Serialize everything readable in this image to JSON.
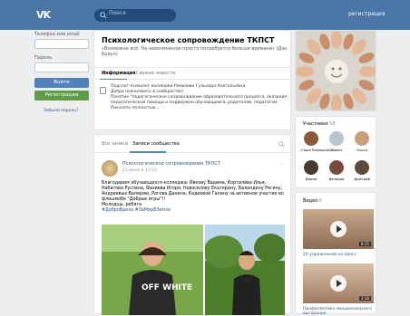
{
  "header": {
    "logo": "VK",
    "search_placeholder": "Поиск",
    "register_link": "регистрация"
  },
  "login": {
    "phone_label": "Телефон или email",
    "password_label": "Пароль",
    "login_button": "Войти",
    "register_button": "Регистрация",
    "forgot_link": "Забыли пароль?"
  },
  "group": {
    "title": "Психологическое сопровождение ТКПСТ",
    "status": "«Возможно всё. На невозможное просто потребуется больше времени» (Дэн Браун)",
    "tabs": [
      "Информация",
      "Свежие новости"
    ],
    "info": "Подслот психолог колледжа Ремизова Гульнара Анатольевна\nДобро пожаловать в сообщество!\nПонятие \"педагогическое сопровождение образовательного процесса, оказания педагогической помощи и поддержки обучающимся, родителям, педагогам.\nПоказать полностью..."
  },
  "feed": {
    "tabs": [
      "Все записи",
      "Записи сообщества"
    ],
    "post": {
      "author": "Психологическое сопровождение ТКПСТ",
      "date": "23 июня в 11:03",
      "text": "Благодарим обучающихся колледжа: Ивкову Вадима, Кортилёва Илья, Набатова Руслана, Фазиева Игоря, Новоселову Екатерину, Баландину Регину, Андреевых Валерию, Рогова Данила, Кадеевой Галину за активное участие во флешмобе \"Добрые игры\"!!",
      "text2": "Молодцы, ребята",
      "hashtags": "#ДоброВдела #ЗаМирВЗемле",
      "photo1_shirt": "OFF WHITE"
    }
  },
  "members": {
    "title": "Участники",
    "count": "58",
    "people": [
      {
        "name": "Саша Ромашкина",
        "color": "#8b5a3c"
      },
      {
        "name": "Павел",
        "color": "#b8c4d0"
      },
      {
        "name": "Ольга",
        "color": "#c9a07a"
      },
      {
        "name": "Ирина",
        "color": "#4a3a30"
      },
      {
        "name": "Валерия",
        "color": "#7a4a3a"
      },
      {
        "name": "Дмитрий",
        "color": "#5d4a3a"
      }
    ]
  },
  "videos": {
    "title": "Видео",
    "count": "4",
    "items": [
      {
        "title": "20 упражнений на пресс",
        "duration": "8:15"
      },
      {
        "title": "Профилактика эмоционального выгорания",
        "duration": "2:36"
      }
    ]
  },
  "colors": {
    "brand": "#4a76a8",
    "link": "#2a5885",
    "login_button": "#5181b8",
    "register_button": "#5f9c48"
  }
}
